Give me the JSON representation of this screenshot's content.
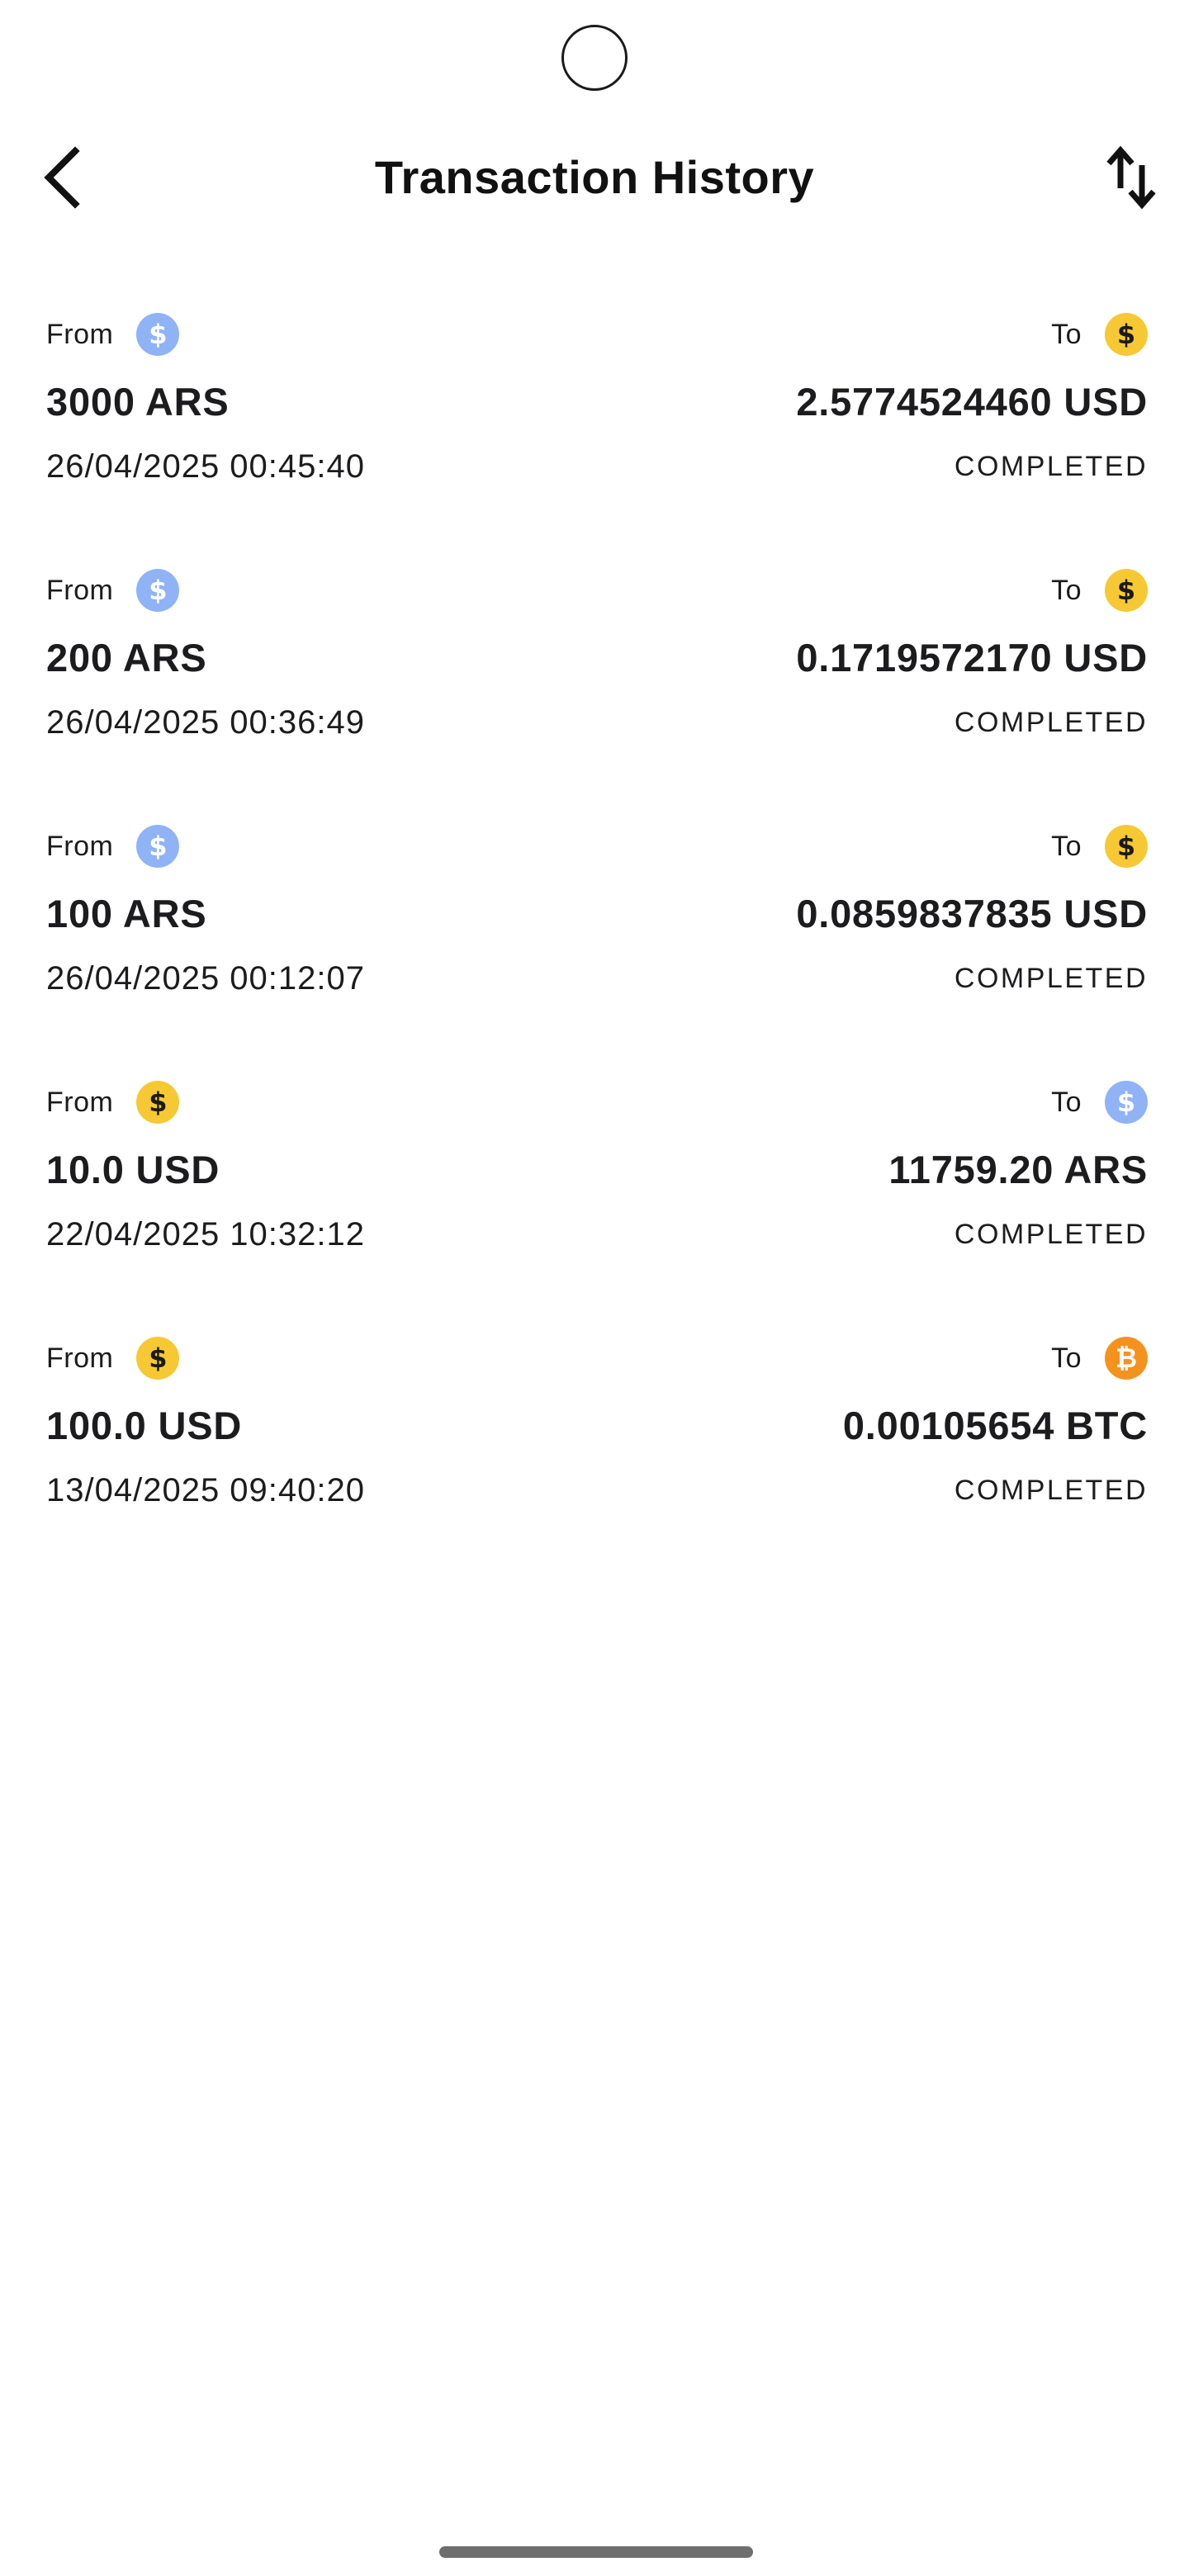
{
  "header": {
    "title": "Transaction History",
    "back_icon": "chevron-left-icon",
    "sort_icon": "sort-arrows-icon"
  },
  "labels": {
    "from": "From",
    "to": "To"
  },
  "coin_colors": {
    "ARS": "#8fb3f5",
    "USD": "#f6c934",
    "BTC": "#f5921e"
  },
  "transactions": [
    {
      "from_label": "From",
      "from_currency": "ARS",
      "from_amount": "3000 ARS",
      "to_label": "To",
      "to_currency": "USD",
      "to_amount": "2.5774524460 USD",
      "date": "26/04/2025 00:45:40",
      "status": "COMPLETED"
    },
    {
      "from_label": "From",
      "from_currency": "ARS",
      "from_amount": "200 ARS",
      "to_label": "To",
      "to_currency": "USD",
      "to_amount": "0.1719572170 USD",
      "date": "26/04/2025 00:36:49",
      "status": "COMPLETED"
    },
    {
      "from_label": "From",
      "from_currency": "ARS",
      "from_amount": "100 ARS",
      "to_label": "To",
      "to_currency": "USD",
      "to_amount": "0.0859837835 USD",
      "date": "26/04/2025 00:12:07",
      "status": "COMPLETED"
    },
    {
      "from_label": "From",
      "from_currency": "USD",
      "from_amount": "10.0 USD",
      "to_label": "To",
      "to_currency": "ARS",
      "to_amount": "11759.20 ARS",
      "date": "22/04/2025 10:32:12",
      "status": "COMPLETED"
    },
    {
      "from_label": "From",
      "from_currency": "USD",
      "from_amount": "100.0 USD",
      "to_label": "To",
      "to_currency": "BTC",
      "to_amount": "0.00105654 BTC",
      "date": "13/04/2025 09:40:20",
      "status": "COMPLETED"
    }
  ]
}
